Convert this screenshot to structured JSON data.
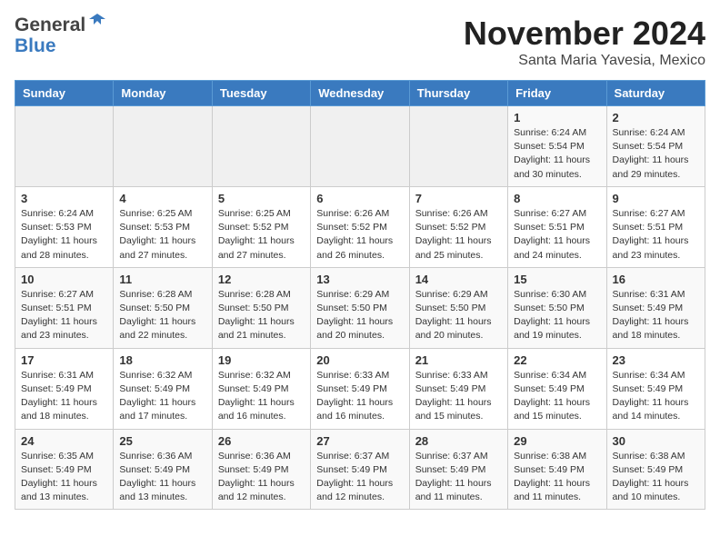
{
  "header": {
    "logo_general": "General",
    "logo_blue": "Blue",
    "title": "November 2024",
    "subtitle": "Santa Maria Yavesia, Mexico"
  },
  "weekdays": [
    "Sunday",
    "Monday",
    "Tuesday",
    "Wednesday",
    "Thursday",
    "Friday",
    "Saturday"
  ],
  "weeks": [
    [
      {
        "day": "",
        "info": ""
      },
      {
        "day": "",
        "info": ""
      },
      {
        "day": "",
        "info": ""
      },
      {
        "day": "",
        "info": ""
      },
      {
        "day": "",
        "info": ""
      },
      {
        "day": "1",
        "info": "Sunrise: 6:24 AM\nSunset: 5:54 PM\nDaylight: 11 hours and 30 minutes."
      },
      {
        "day": "2",
        "info": "Sunrise: 6:24 AM\nSunset: 5:54 PM\nDaylight: 11 hours and 29 minutes."
      }
    ],
    [
      {
        "day": "3",
        "info": "Sunrise: 6:24 AM\nSunset: 5:53 PM\nDaylight: 11 hours and 28 minutes."
      },
      {
        "day": "4",
        "info": "Sunrise: 6:25 AM\nSunset: 5:53 PM\nDaylight: 11 hours and 27 minutes."
      },
      {
        "day": "5",
        "info": "Sunrise: 6:25 AM\nSunset: 5:52 PM\nDaylight: 11 hours and 27 minutes."
      },
      {
        "day": "6",
        "info": "Sunrise: 6:26 AM\nSunset: 5:52 PM\nDaylight: 11 hours and 26 minutes."
      },
      {
        "day": "7",
        "info": "Sunrise: 6:26 AM\nSunset: 5:52 PM\nDaylight: 11 hours and 25 minutes."
      },
      {
        "day": "8",
        "info": "Sunrise: 6:27 AM\nSunset: 5:51 PM\nDaylight: 11 hours and 24 minutes."
      },
      {
        "day": "9",
        "info": "Sunrise: 6:27 AM\nSunset: 5:51 PM\nDaylight: 11 hours and 23 minutes."
      }
    ],
    [
      {
        "day": "10",
        "info": "Sunrise: 6:27 AM\nSunset: 5:51 PM\nDaylight: 11 hours and 23 minutes."
      },
      {
        "day": "11",
        "info": "Sunrise: 6:28 AM\nSunset: 5:50 PM\nDaylight: 11 hours and 22 minutes."
      },
      {
        "day": "12",
        "info": "Sunrise: 6:28 AM\nSunset: 5:50 PM\nDaylight: 11 hours and 21 minutes."
      },
      {
        "day": "13",
        "info": "Sunrise: 6:29 AM\nSunset: 5:50 PM\nDaylight: 11 hours and 20 minutes."
      },
      {
        "day": "14",
        "info": "Sunrise: 6:29 AM\nSunset: 5:50 PM\nDaylight: 11 hours and 20 minutes."
      },
      {
        "day": "15",
        "info": "Sunrise: 6:30 AM\nSunset: 5:50 PM\nDaylight: 11 hours and 19 minutes."
      },
      {
        "day": "16",
        "info": "Sunrise: 6:31 AM\nSunset: 5:49 PM\nDaylight: 11 hours and 18 minutes."
      }
    ],
    [
      {
        "day": "17",
        "info": "Sunrise: 6:31 AM\nSunset: 5:49 PM\nDaylight: 11 hours and 18 minutes."
      },
      {
        "day": "18",
        "info": "Sunrise: 6:32 AM\nSunset: 5:49 PM\nDaylight: 11 hours and 17 minutes."
      },
      {
        "day": "19",
        "info": "Sunrise: 6:32 AM\nSunset: 5:49 PM\nDaylight: 11 hours and 16 minutes."
      },
      {
        "day": "20",
        "info": "Sunrise: 6:33 AM\nSunset: 5:49 PM\nDaylight: 11 hours and 16 minutes."
      },
      {
        "day": "21",
        "info": "Sunrise: 6:33 AM\nSunset: 5:49 PM\nDaylight: 11 hours and 15 minutes."
      },
      {
        "day": "22",
        "info": "Sunrise: 6:34 AM\nSunset: 5:49 PM\nDaylight: 11 hours and 15 minutes."
      },
      {
        "day": "23",
        "info": "Sunrise: 6:34 AM\nSunset: 5:49 PM\nDaylight: 11 hours and 14 minutes."
      }
    ],
    [
      {
        "day": "24",
        "info": "Sunrise: 6:35 AM\nSunset: 5:49 PM\nDaylight: 11 hours and 13 minutes."
      },
      {
        "day": "25",
        "info": "Sunrise: 6:36 AM\nSunset: 5:49 PM\nDaylight: 11 hours and 13 minutes."
      },
      {
        "day": "26",
        "info": "Sunrise: 6:36 AM\nSunset: 5:49 PM\nDaylight: 11 hours and 12 minutes."
      },
      {
        "day": "27",
        "info": "Sunrise: 6:37 AM\nSunset: 5:49 PM\nDaylight: 11 hours and 12 minutes."
      },
      {
        "day": "28",
        "info": "Sunrise: 6:37 AM\nSunset: 5:49 PM\nDaylight: 11 hours and 11 minutes."
      },
      {
        "day": "29",
        "info": "Sunrise: 6:38 AM\nSunset: 5:49 PM\nDaylight: 11 hours and 11 minutes."
      },
      {
        "day": "30",
        "info": "Sunrise: 6:38 AM\nSunset: 5:49 PM\nDaylight: 11 hours and 10 minutes."
      }
    ]
  ]
}
